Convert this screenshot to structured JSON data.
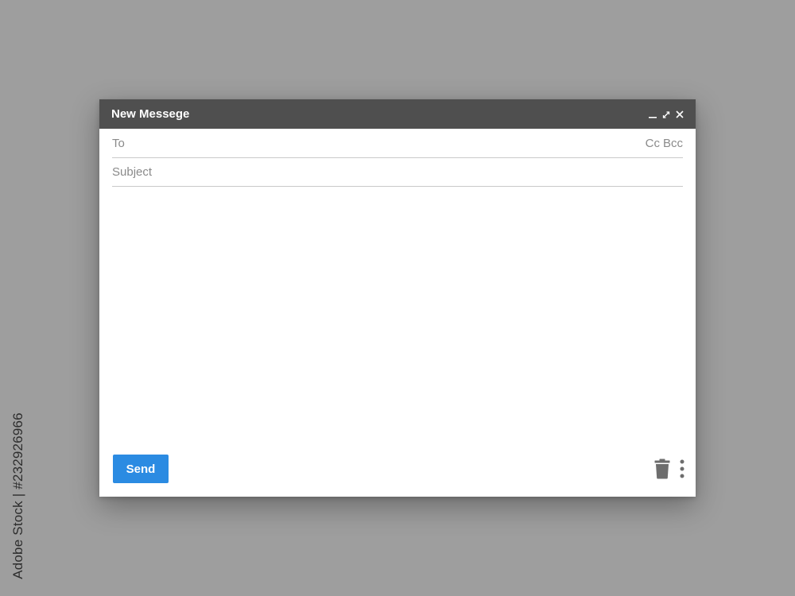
{
  "window": {
    "title": "New Messege"
  },
  "compose": {
    "to_placeholder": "To",
    "cc_label": "Cc",
    "bcc_label": "Bcc",
    "subject_placeholder": "Subject",
    "body_value": ""
  },
  "footer": {
    "send_label": "Send"
  },
  "icons": {
    "minimize": "minimize-icon",
    "expand": "expand-icon",
    "close": "close-icon",
    "delete": "trash-icon",
    "more": "more-vertical-icon"
  },
  "watermark": {
    "side_text": "Adobe Stock | #232926966"
  },
  "colors": {
    "background": "#9e9e9e",
    "titlebar": "#4f4f4f",
    "send_button": "#2b8be2",
    "icon": "#6d6d6d"
  }
}
